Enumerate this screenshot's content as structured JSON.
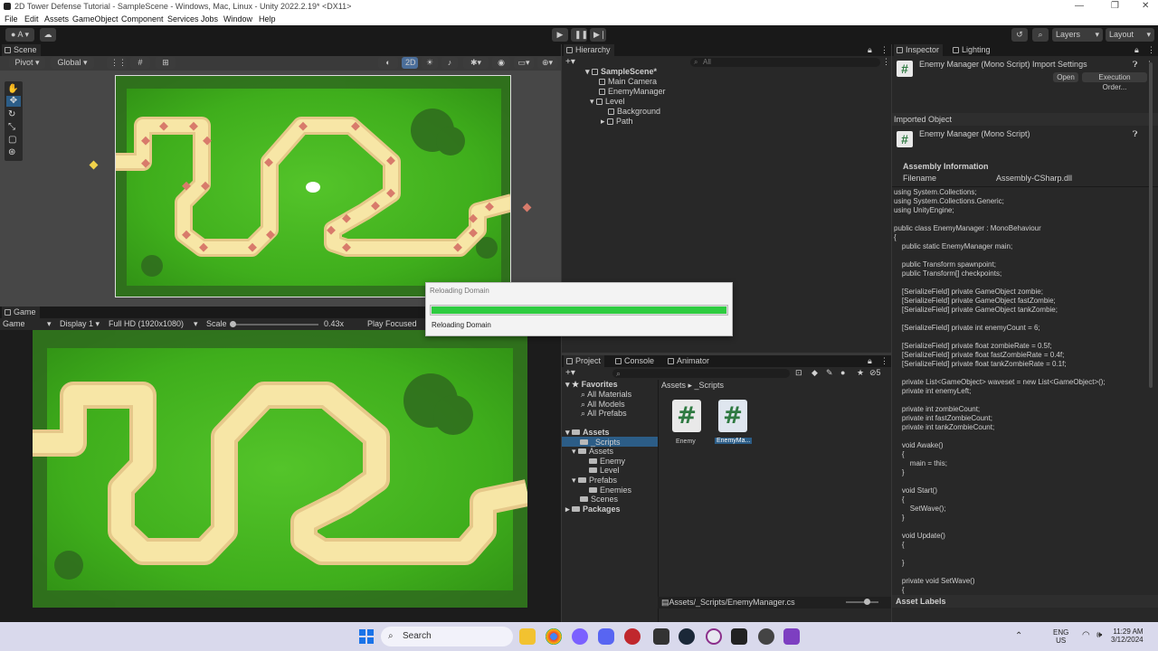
{
  "window": {
    "title": "2D Tower Defense Tutorial - SampleScene - Windows, Mac, Linux - Unity 2022.2.19* <DX11>",
    "controls": [
      "—",
      "❐",
      "✕"
    ]
  },
  "menu": [
    "File",
    "Edit",
    "Assets",
    "GameObject",
    "Component",
    "Services",
    "Jobs",
    "Window",
    "Help"
  ],
  "toolbar": {
    "account": "A",
    "layers": "Layers",
    "layout": "Layout",
    "play": "▶",
    "pause": "❚❚",
    "step": "▶❘"
  },
  "scene": {
    "tab": "Scene",
    "pivot": "Pivot",
    "global": "Global",
    "mode2d": "2D"
  },
  "game": {
    "tab": "Game",
    "display_mode": "Game",
    "display": "Display 1",
    "resolution": "Full HD (1920x1080)",
    "scale_label": "Scale",
    "scale_value": "0.43x",
    "play_focused": "Play Focused"
  },
  "hierarchy": {
    "tab": "Hierarchy",
    "search_placeholder": "All",
    "items": [
      {
        "label": "SampleScene*",
        "bold": true
      },
      {
        "label": "Main Camera"
      },
      {
        "label": "EnemyManager"
      },
      {
        "label": "Level"
      },
      {
        "label": "Background"
      },
      {
        "label": "Path"
      }
    ]
  },
  "dialog": {
    "title": "Reloading Domain",
    "progress": 1.0,
    "status": "Reloading Domain"
  },
  "inspector": {
    "tabs": [
      "Inspector",
      "Lighting"
    ],
    "header": "Enemy Manager (Mono Script) Import Settings",
    "open_btn": "Open",
    "exec_btn": "Execution Order...",
    "imported_object": "Imported Object",
    "object_name": "Enemy Manager (Mono Script)",
    "assembly_info": "Assembly Information",
    "filename_label": "Filename",
    "filename_value": "Assembly-CSharp.dll",
    "asset_labels": "Asset Labels",
    "code": [
      "using System.Collections;",
      "using System.Collections.Generic;",
      "using UnityEngine;",
      "",
      "public class EnemyManager : MonoBehaviour",
      "{",
      "    public static EnemyManager main;",
      "",
      "    public Transform spawnpoint;",
      "    public Transform[] checkpoints;",
      "",
      "    [SerializeField] private GameObject zombie;",
      "    [SerializeField] private GameObject fastZombie;",
      "    [SerializeField] private GameObject tankZombie;",
      "",
      "    [SerializeField] private int enemyCount = 6;",
      "",
      "    [SerializeField] private float zombieRate = 0.5f;",
      "    [SerializeField] private float fastZombieRate = 0.4f;",
      "    [SerializeField] private float tankZombieRate = 0.1f;",
      "",
      "    private List<GameObject> waveset = new List<GameObject>();",
      "    private int enemyLeft;",
      "",
      "    private int zombieCount;",
      "    private int fastZombieCount;",
      "    private int tankZombieCount;",
      "",
      "    void Awake()",
      "    {",
      "        main = this;",
      "    }",
      "",
      "    void Start()",
      "    {",
      "        SetWave();",
      "    }",
      "",
      "    void Update()",
      "    {",
      "",
      "    }",
      "",
      "    private void SetWave()",
      "    {"
    ]
  },
  "project": {
    "tabs": [
      "Project",
      "Console",
      "Animator"
    ],
    "count": "5",
    "breadcrumb": [
      "Assets",
      "_Scripts"
    ],
    "favorites": "Favorites",
    "fav_items": [
      "All Materials",
      "All Models",
      "All Prefabs"
    ],
    "assets_root": "Assets",
    "tree": [
      {
        "label": "_Scripts",
        "depth": 1,
        "sel": true
      },
      {
        "label": "Assets",
        "depth": 1
      },
      {
        "label": "Enemy",
        "depth": 2
      },
      {
        "label": "Level",
        "depth": 2
      },
      {
        "label": "Prefabs",
        "depth": 1
      },
      {
        "label": "Enemies",
        "depth": 2
      },
      {
        "label": "Scenes",
        "depth": 1
      }
    ],
    "packages": "Packages",
    "files": [
      {
        "name": "Enemy"
      },
      {
        "name": "EnemyMa..."
      }
    ],
    "path": "Assets/_Scripts/EnemyManager.cs"
  },
  "taskbar": {
    "search": "Search",
    "lang1": "ENG",
    "lang2": "US",
    "time": "11:29 AM",
    "date": "3/12/2024"
  },
  "colors": {
    "grass": "#3fae1c",
    "path": "#f7e6a6",
    "path_edge": "#e6c88a",
    "bush": "#2f6b1e",
    "progress": "#2ecc40",
    "selection": "#2c5d87"
  }
}
